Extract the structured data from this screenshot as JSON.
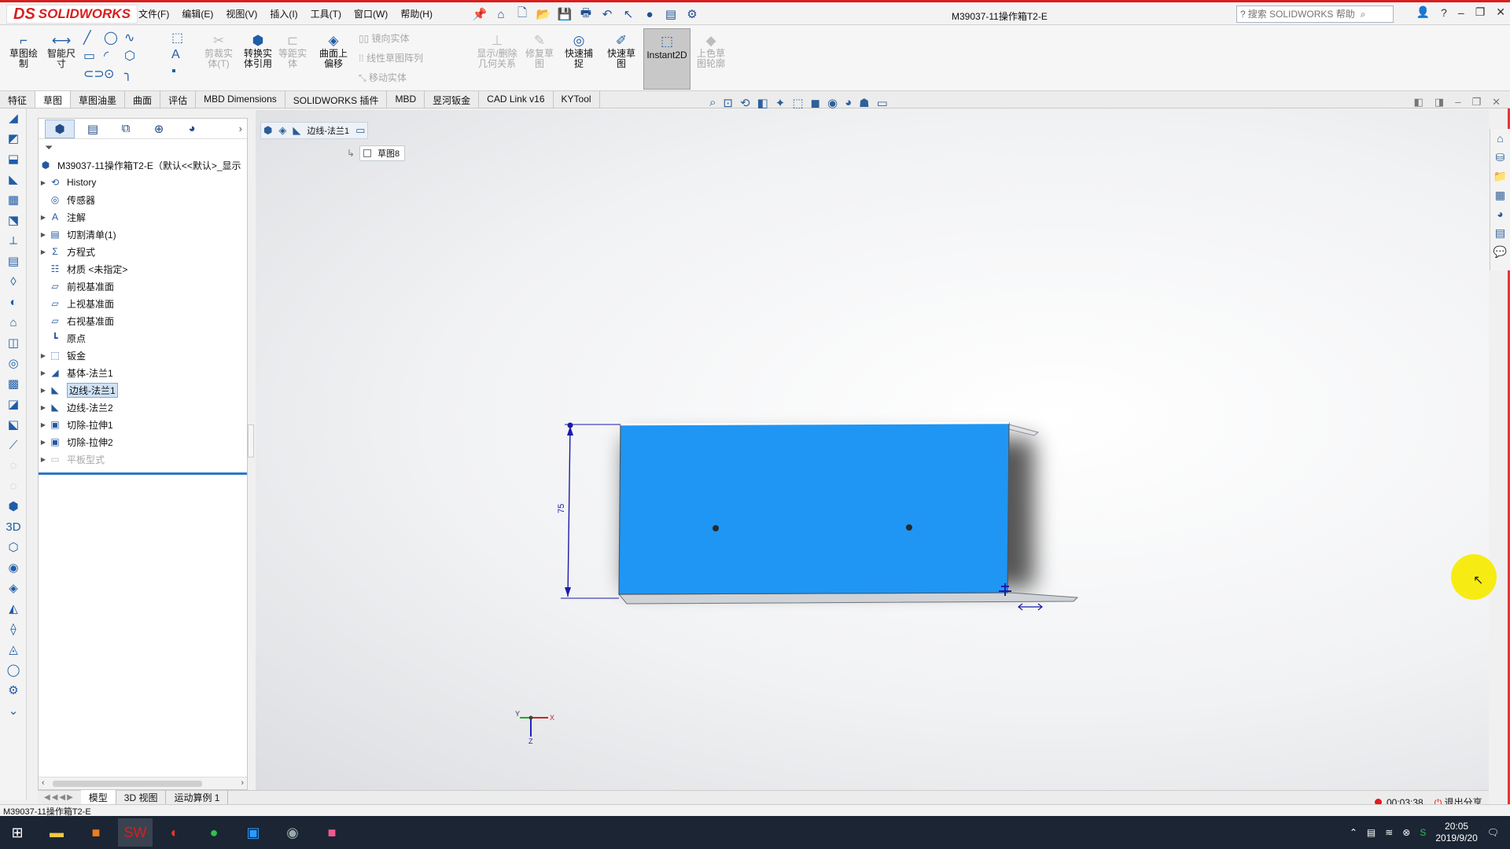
{
  "app": {
    "logo_ds": "DS",
    "logo_text": "SOLIDWORKS",
    "doc_title": "M39037-11操作箱T2-E"
  },
  "menu": [
    "文件(F)",
    "编辑(E)",
    "视图(V)",
    "插入(I)",
    "工具(T)",
    "窗口(W)",
    "帮助(H)"
  ],
  "search": {
    "placeholder": "搜索 SOLIDWORKS 帮助"
  },
  "ribbon": {
    "sketch_label": "草图绘制",
    "smart_dim_label": "智能尺寸",
    "trim_label": "剪裁实体(T)",
    "convert_label": "转换实体引用",
    "offset_label": "等距实体",
    "surface_offset_label": "曲面上偏移",
    "mirror_label": "镜向实体",
    "linear_pattern_label": "线性草图阵列",
    "move_label": "移动实体",
    "display_relations_label": "显示/删除几何关系",
    "repair_label": "修复草图",
    "quick_snap_label": "快速捕捉",
    "rapid_sketch_label": "快速草图",
    "instant2d_label": "Instant2D",
    "shaded_label": "上色草图轮廓"
  },
  "tabs": [
    "特征",
    "草图",
    "草图油墨",
    "曲面",
    "评估",
    "MBD Dimensions",
    "SOLIDWORKS 插件",
    "MBD",
    "昱河钣金",
    "CAD Link v16",
    "KYTool"
  ],
  "tree": {
    "root": "M39037-11操作箱T2-E（默认<<默认>_显示",
    "items": [
      {
        "label": "History",
        "icon": "history-icon",
        "exp": true
      },
      {
        "label": "传感器",
        "icon": "sensor-icon",
        "exp": false
      },
      {
        "label": "注解",
        "icon": "annotation-icon",
        "exp": true
      },
      {
        "label": "切割清单(1)",
        "icon": "cutlist-icon",
        "exp": true
      },
      {
        "label": "方程式",
        "icon": "equation-icon",
        "exp": true
      },
      {
        "label": "材质 <未指定>",
        "icon": "material-icon",
        "exp": false
      },
      {
        "label": "前视基准面",
        "icon": "plane-icon",
        "exp": false
      },
      {
        "label": "上视基准面",
        "icon": "plane-icon",
        "exp": false
      },
      {
        "label": "右视基准面",
        "icon": "plane-icon",
        "exp": false
      },
      {
        "label": "原点",
        "icon": "origin-icon",
        "exp": false
      },
      {
        "label": "钣金",
        "icon": "sheetmetal-icon",
        "exp": true
      },
      {
        "label": "基体-法兰1",
        "icon": "base-flange-icon",
        "exp": true
      },
      {
        "label": "边线-法兰1",
        "icon": "edge-flange-icon",
        "exp": true,
        "selected": true
      },
      {
        "label": "边线-法兰2",
        "icon": "edge-flange-icon",
        "exp": true
      },
      {
        "label": "切除-拉伸1",
        "icon": "cut-extrude-icon",
        "exp": true
      },
      {
        "label": "切除-拉伸2",
        "icon": "cut-extrude-icon",
        "exp": true
      },
      {
        "label": "平板型式",
        "icon": "flat-pattern-icon",
        "exp": true,
        "grey": true
      }
    ]
  },
  "breadcrumb": {
    "feature": "边线-法兰1",
    "sketch": "草图8"
  },
  "dimension": {
    "value": "75"
  },
  "triad": {
    "x": "X",
    "y": "Y",
    "z": "Z"
  },
  "bottom_tabs": [
    "模型",
    "3D 视图",
    "运动算例 1"
  ],
  "status": {
    "text": "M39037-11操作箱T2-E"
  },
  "recording": {
    "time": "00:03:38",
    "exit_label": "退出分享"
  },
  "clock": {
    "time": "20:05",
    "date": "2019/9/20"
  },
  "colors": {
    "part_blue": "#1f96f3",
    "accent_red": "#d81e1e",
    "cursor_yellow": "#f6ec14"
  }
}
